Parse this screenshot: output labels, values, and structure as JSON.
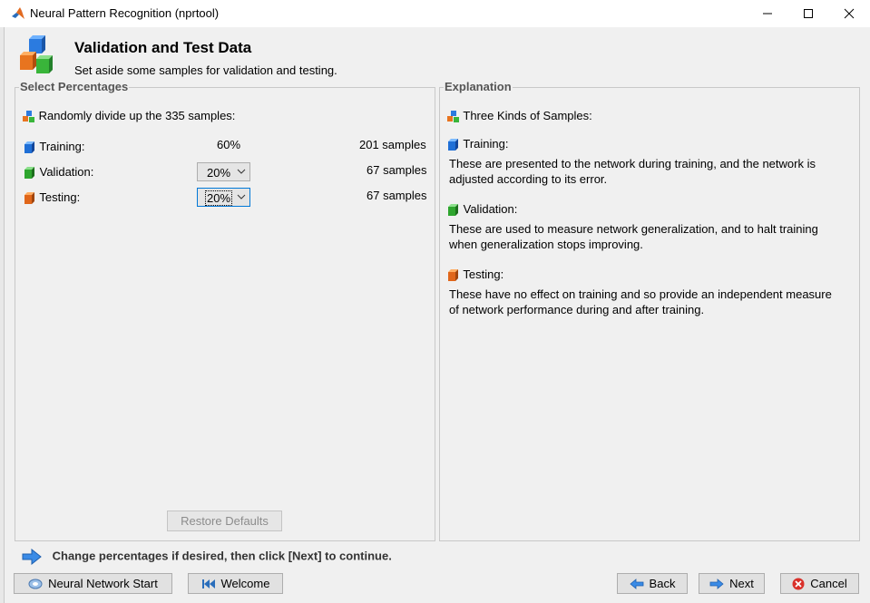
{
  "window": {
    "title": "Neural Pattern Recognition (nprtool)"
  },
  "header": {
    "title": "Validation and Test Data",
    "subtitle": "Set aside some samples for validation and testing."
  },
  "select_panel": {
    "label": "Select Percentages",
    "intro": "Randomly divide up the 335 samples:",
    "rows": [
      {
        "label": "Training:",
        "percent": "60%",
        "samples": "201 samples",
        "color": "#1f6fd6"
      },
      {
        "label": "Validation:",
        "percent": "20%",
        "samples": "67 samples",
        "color": "#2ea52e"
      },
      {
        "label": "Testing:",
        "percent": "20%",
        "samples": "67 samples",
        "color": "#e0661a"
      }
    ],
    "restore_defaults": "Restore Defaults"
  },
  "explanation_panel": {
    "label": "Explanation",
    "intro": "Three Kinds of Samples:",
    "training_title": "Training:",
    "training_text": "These are presented to the network during training, and the network is adjusted according to its error.",
    "validation_title": "Validation:",
    "validation_text": "These are used to measure network generalization, and to halt training when generalization stops improving.",
    "testing_title": "Testing:",
    "testing_text": "These have no effect on training and so provide an independent measure of network performance during and after training."
  },
  "footer": {
    "hint": "Change percentages if desired, then click [Next] to continue.",
    "buttons": {
      "start": "Neural Network Start",
      "welcome": "Welcome",
      "back": "Back",
      "next": "Next",
      "cancel": "Cancel"
    }
  }
}
